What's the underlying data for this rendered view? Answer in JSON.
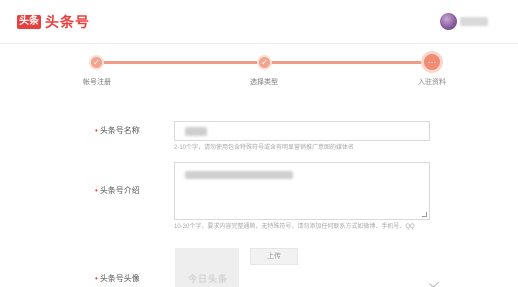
{
  "header": {
    "logo_badge": "头条",
    "logo_text": "头条号"
  },
  "steps": [
    {
      "label": "帐号注册",
      "icon": "check-icon",
      "state": "done"
    },
    {
      "label": "选择类型",
      "icon": "check-icon",
      "state": "done"
    },
    {
      "label": "入驻资料",
      "icon": "ellipsis-icon",
      "state": "active"
    }
  ],
  "form": {
    "name": {
      "label": "头条号名称",
      "hint": "2-10个字，请勿使用包含特殊符号或含有明显营销推广意图的媒体名"
    },
    "intro": {
      "label": "头条号介绍",
      "hint": "10-30个字，要求内容完整通顺，无特殊符号，请勿添加任何联系方式如微博、手机号、QQ"
    },
    "avatar": {
      "label": "头条号头像",
      "upload_label": "上传",
      "placeholder": "今日头条"
    }
  },
  "colors": {
    "brand": "#e8403f",
    "step": "#f08c73"
  }
}
